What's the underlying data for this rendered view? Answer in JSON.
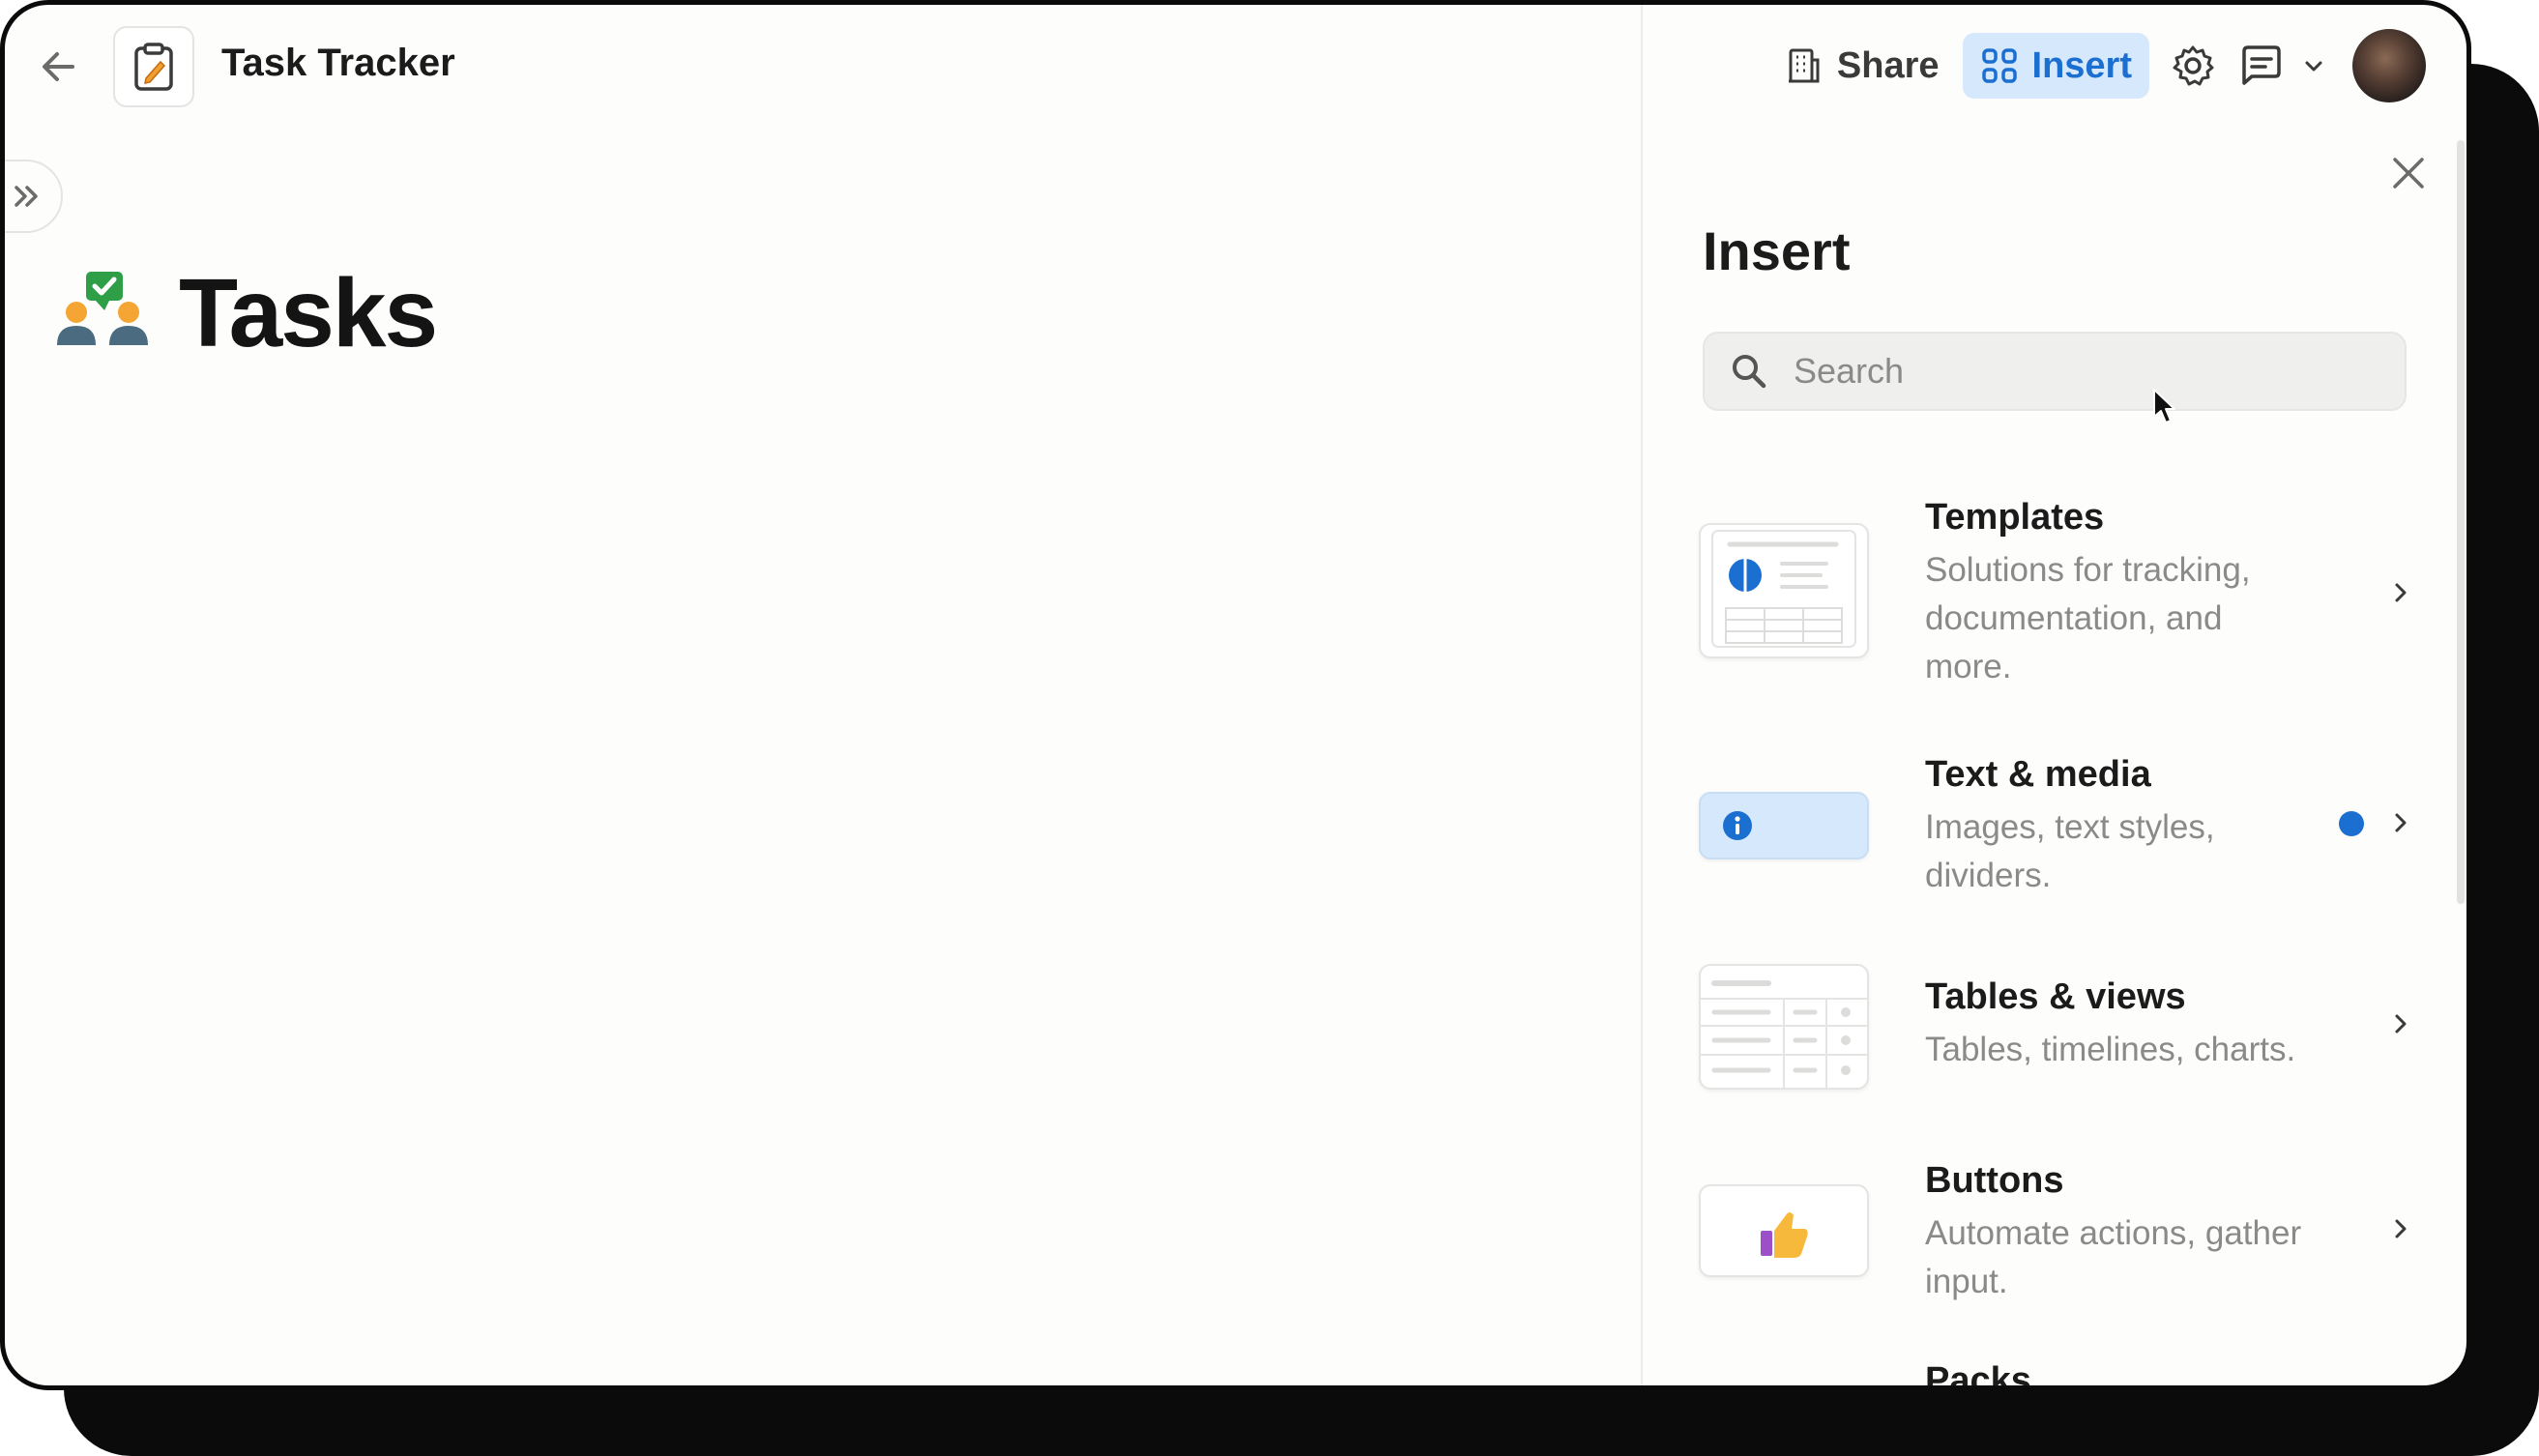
{
  "header": {
    "doc_title": "Task Tracker",
    "share_label": "Share",
    "insert_label": "Insert"
  },
  "page": {
    "title": "Tasks"
  },
  "insert_panel": {
    "title": "Insert",
    "search_placeholder": "Search",
    "items": [
      {
        "title": "Templates",
        "desc_lines": [
          "Solutions for tracking,",
          "documentation, and",
          "more."
        ]
      },
      {
        "title": "Text & media",
        "desc_lines": [
          "Images, text styles,",
          "dividers."
        ],
        "has_new_dot": true
      },
      {
        "title": "Tables & views",
        "desc_lines": [
          "Tables, timelines, charts."
        ]
      },
      {
        "title": "Buttons",
        "desc_lines": [
          "Automate actions, gather",
          "input."
        ]
      },
      {
        "title": "Packs"
      }
    ]
  },
  "colors": {
    "accent": "#1a6fd0",
    "accent_bg": "#d6e8fb",
    "text_muted": "#8a8a88"
  },
  "icons": {
    "back": "arrow-left-icon",
    "doc": "clipboard-pencil-icon",
    "expand": "double-chevron-right-icon",
    "page": "people-checkmark-icon",
    "share": "building-icon",
    "insert": "grid-plus-icon",
    "settings": "gear-icon",
    "comments": "comment-icon",
    "dropdown": "chevron-down-icon",
    "close": "close-icon",
    "search": "search-icon",
    "chevron": "chevron-right-icon"
  }
}
